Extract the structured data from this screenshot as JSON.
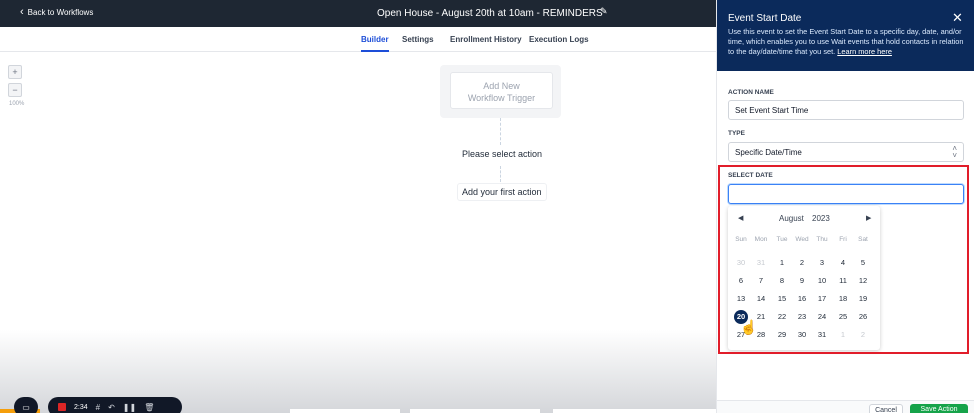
{
  "header": {
    "back_label": "Back to Workflows",
    "title": "Open House - August 20th at 10am - REMINDERS"
  },
  "tabs": [
    {
      "label": "Builder",
      "active": true
    },
    {
      "label": "Settings",
      "active": false
    },
    {
      "label": "Enrollment History",
      "active": false
    },
    {
      "label": "Execution Logs",
      "active": false
    }
  ],
  "canvas": {
    "zoom_in": "+",
    "zoom_out": "−",
    "zoom_level": "100%",
    "trigger_line1": "Add New",
    "trigger_line2": "Workflow Trigger",
    "select_action": "Please select action",
    "first_action": "Add your first action"
  },
  "recorder": {
    "time": "2:34"
  },
  "panel": {
    "title": "Event Start Date",
    "description": "Use this event to set the Event Start Date to a specific day, date, and/or time, which enables you to use Wait events that hold contacts in relation to the day/date/time that you set.",
    "learn_more": "Learn more here",
    "action_name_label": "ACTION NAME",
    "action_name_value": "Set Event Start Time",
    "type_label": "TYPE",
    "type_value": "Specific Date/Time",
    "select_date_label": "SELECT DATE",
    "select_date_value": "",
    "cancel_label": "Cancel",
    "save_label": "Save Action"
  },
  "calendar": {
    "month": "August",
    "year": "2023",
    "weekdays": [
      "Sun",
      "Mon",
      "Tue",
      "Wed",
      "Thu",
      "Fri",
      "Sat"
    ],
    "weeks": [
      [
        "30",
        "31",
        "1",
        "2",
        "3",
        "4",
        "5"
      ],
      [
        "6",
        "7",
        "8",
        "9",
        "10",
        "11",
        "12"
      ],
      [
        "13",
        "14",
        "15",
        "16",
        "17",
        "18",
        "19"
      ],
      [
        "20",
        "21",
        "22",
        "23",
        "24",
        "25",
        "26"
      ],
      [
        "27",
        "28",
        "29",
        "30",
        "31",
        "1",
        "2"
      ]
    ],
    "selected": "20",
    "accent_color": "#0b2a5b"
  },
  "colors": {
    "header_bg": "#1e2733",
    "panel_header_bg": "#0b2a5b",
    "active_tab": "#1d4ed8",
    "highlight_border": "#e11d2a",
    "save_button": "#16a34a"
  }
}
